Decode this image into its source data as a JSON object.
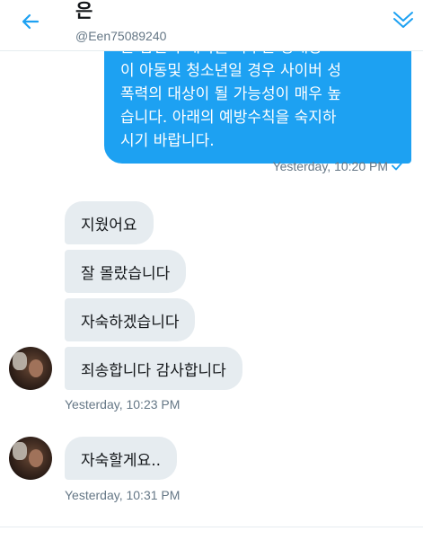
{
  "header": {
    "name": "은",
    "handle": "@Een75089240"
  },
  "outgoing": {
    "lines": [
      "는 답신과 대화를 나누는 상대방",
      "이 아동및 청소년일 경우 사이버 성",
      "폭력의 대상이 될 가능성이 매우 높",
      "습니다. 아래의 예방수칙을 숙지하",
      "시기 바랍니다."
    ],
    "timestamp": "Yesterday, 10:20 PM"
  },
  "incoming": {
    "group1": {
      "messages": [
        "지웠어요",
        "잘 몰랐습니다",
        "자숙하겠습니다",
        "죄송합니다 감사합니다"
      ],
      "timestamp": "Yesterday, 10:23 PM"
    },
    "group2": {
      "messages": [
        "자숙할게요.."
      ],
      "timestamp": "Yesterday, 10:31 PM"
    }
  },
  "icons": {
    "back": "back-arrow-icon",
    "chevron": "chevron-down-icon",
    "read_check": "check-icon"
  },
  "colors": {
    "accent": "#1da1f2",
    "incoming_bubble": "#e6ecf0",
    "meta_text": "#657786"
  }
}
